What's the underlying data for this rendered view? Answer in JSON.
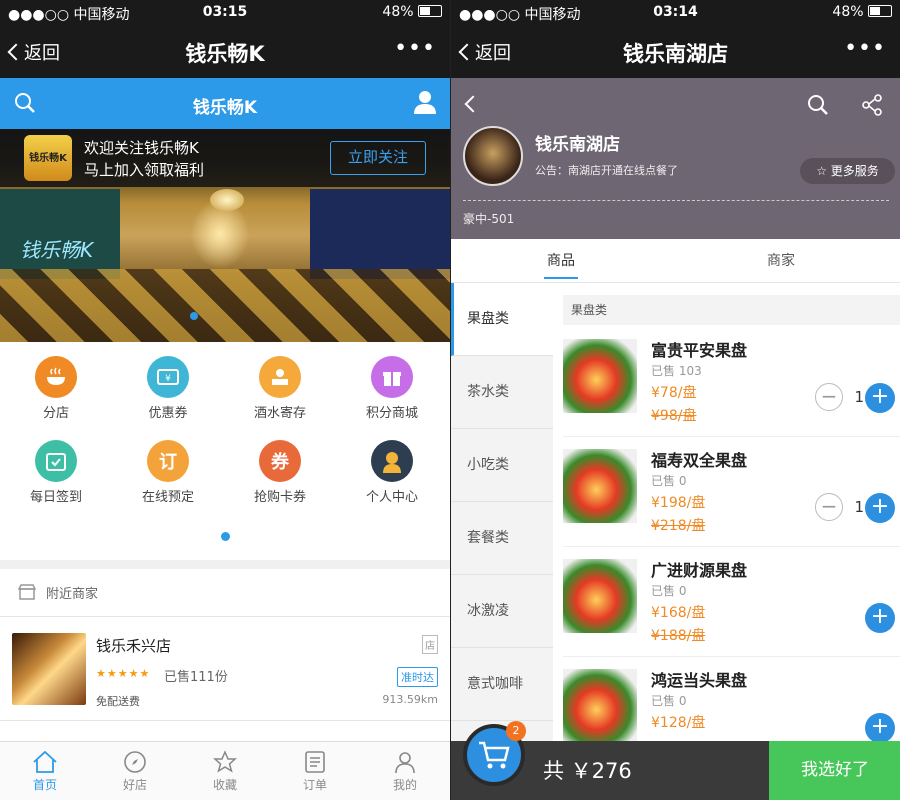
{
  "left": {
    "status": {
      "carrier": "●●●○○ 中国移动",
      "time": "03:15",
      "battery": "48%"
    },
    "nav": {
      "back": "返回",
      "title": "钱乐畅K",
      "more": "•••"
    },
    "bar_title": "钱乐畅K",
    "follow": {
      "logo": "钱乐畅K",
      "line1": "欢迎关注钱乐畅K",
      "line2": "马上加入领取福利",
      "button": "立即关注"
    },
    "banner_sign": "钱乐畅K",
    "grid": [
      {
        "label": "分店",
        "color": "#f08a24",
        "icon": "restaurant-icon"
      },
      {
        "label": "优惠券",
        "color": "#3fb6d6",
        "icon": "coupon-icon"
      },
      {
        "label": "酒水寄存",
        "color": "#f4a93a",
        "icon": "storage-icon"
      },
      {
        "label": "积分商城",
        "color": "#c66ee8",
        "icon": "gift-icon"
      },
      {
        "label": "每日签到",
        "color": "#3dbfa6",
        "icon": "calendar-icon"
      },
      {
        "label": "在线预定",
        "color": "#f4a33a",
        "icon": "booking-icon"
      },
      {
        "label": "抢购卡券",
        "color": "#e86a3a",
        "icon": "ticket-icon"
      },
      {
        "label": "个人中心",
        "color": "#2c3e50",
        "icon": "user-icon"
      }
    ],
    "nearby": "附近商家",
    "store": {
      "name": "钱乐禾兴店",
      "tag": "店",
      "stars": "★★★★★",
      "sold": "已售111份",
      "ontime": "准时达",
      "fee": "免配送费",
      "dist": "913.59km"
    },
    "tabs": [
      "首页",
      "好店",
      "收藏",
      "订单",
      "我的"
    ]
  },
  "right": {
    "status": {
      "carrier": "●●●○○ 中国移动",
      "time": "03:14",
      "battery": "48%"
    },
    "nav": {
      "back": "返回",
      "title": "钱乐南湖店",
      "more": "•••"
    },
    "shop": {
      "name": "钱乐南湖店",
      "notice": "公告：南湖店开通在线点餐了",
      "more_service": "更多服务",
      "room": "豪中-501"
    },
    "tabs": {
      "goods": "商品",
      "merchant": "商家"
    },
    "categories": [
      "果盘类",
      "茶水类",
      "小吃类",
      "套餐类",
      "冰激凌",
      "意式咖啡"
    ],
    "section": "果盘类",
    "products": [
      {
        "name": "富贵平安果盘",
        "sold": "已售 103",
        "price": "¥78/盘",
        "old": "¥98/盘",
        "qty": "1"
      },
      {
        "name": "福寿双全果盘",
        "sold": "已售 0",
        "price": "¥198/盘",
        "old": "¥218/盘",
        "qty": "1"
      },
      {
        "name": "广进财源果盘",
        "sold": "已售 0",
        "price": "¥168/盘",
        "old": "¥188/盘",
        "qty": ""
      },
      {
        "name": "鸿运当头果盘",
        "sold": "已售 0",
        "price": "¥128/盘",
        "old": "",
        "qty": ""
      }
    ],
    "cart": {
      "badge": "2",
      "total": "共 ￥276",
      "checkout": "我选好了"
    }
  }
}
